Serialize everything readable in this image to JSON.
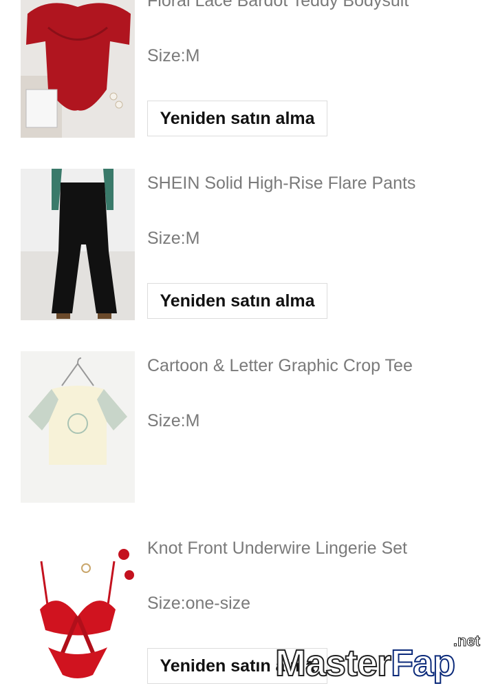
{
  "orders": [
    {
      "title": "Floral Lace Bardot Teddy Bodysuit",
      "size": "Size:M",
      "button": "Yeniden satın alma"
    },
    {
      "title": "SHEIN Solid High-Rise Flare Pants",
      "size": "Size:M",
      "button": "Yeniden satın alma"
    },
    {
      "title": "Cartoon & Letter Graphic Crop Tee",
      "size": "Size:M"
    },
    {
      "title": "Knot Front Underwire Lingerie Set",
      "size": "Size:one-size",
      "button": "Yeniden satın alma"
    }
  ],
  "watermark": {
    "main": "Master",
    "accent": "Fap",
    "suffix": ".net"
  },
  "colors": {
    "title_text": "#7a7a7a",
    "button_text": "#111111",
    "button_border": "#dcdcdc",
    "watermark_accent": "#0b2a7a"
  }
}
